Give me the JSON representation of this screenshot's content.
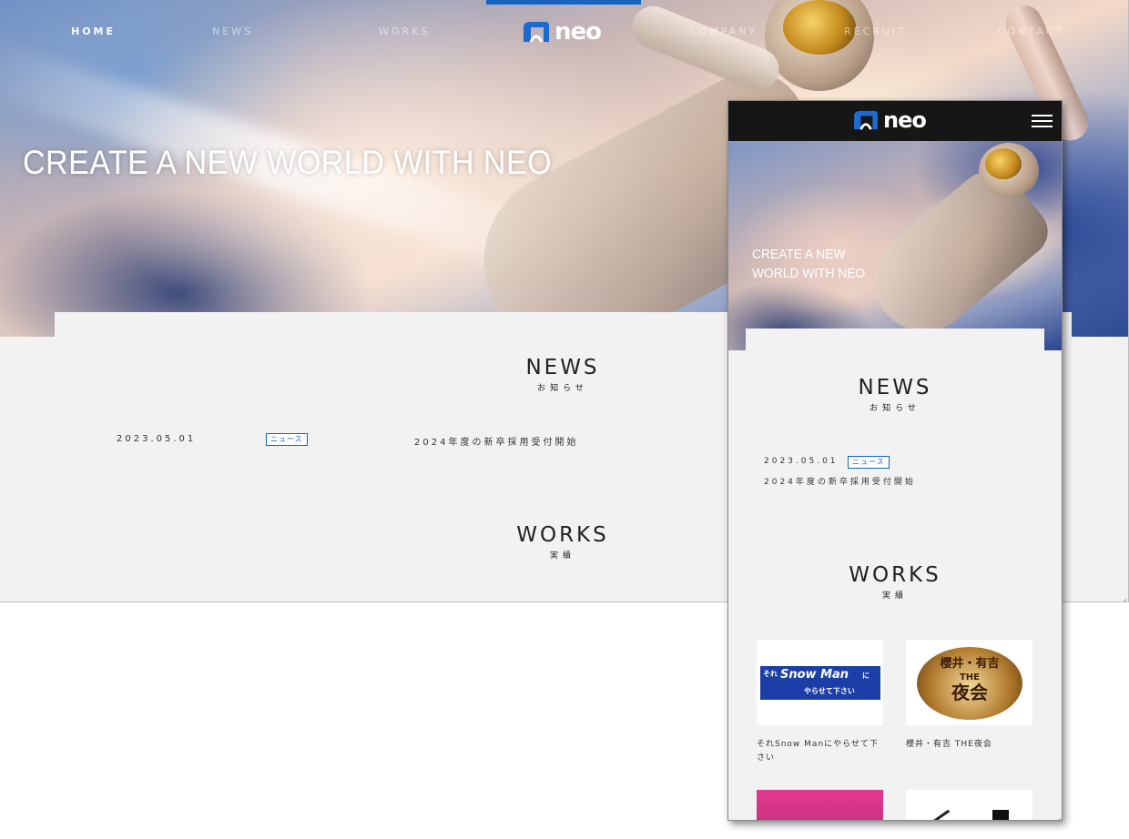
{
  "desktop": {
    "nav": [
      "HOME",
      "NEWS",
      "WORKS",
      "COMPANY",
      "RECRUIT",
      "CONTACT"
    ],
    "active_nav": "HOME",
    "logo_text": "neo",
    "hero_tagline": "CREATE A NEW WORLD WITH NEO",
    "news": {
      "title": "NEWS",
      "subtitle": "お知らせ",
      "items": [
        {
          "date": "2023.05.01",
          "category": "ニュース",
          "title": "2024年度の新卒採用受付開始"
        }
      ]
    },
    "works": {
      "title": "WORKS",
      "subtitle": "実績"
    }
  },
  "mobile": {
    "logo_text": "neo",
    "hero_tagline": "CREATE A NEW WORLD WITH NEO",
    "news": {
      "title": "NEWS",
      "subtitle": "お知らせ",
      "items": [
        {
          "date": "2023.05.01",
          "category": "ニュース",
          "title": "2024年度の新卒採用受付開始"
        }
      ]
    },
    "works": {
      "title": "WORKS",
      "subtitle": "実績",
      "items": [
        {
          "caption": "それSnow Manにやらせて下さい",
          "logo_text_1": "それ",
          "logo_text_2": "Snow Man",
          "logo_text_3": "に",
          "logo_text_4": "やらせて下さい"
        },
        {
          "caption": "櫻井・有吉 THE夜会",
          "logo_text_1": "櫻井・有吉",
          "logo_text_2": "THE",
          "logo_text_3": "夜会"
        }
      ]
    }
  },
  "colors": {
    "accent": "#1565c0",
    "header_dark": "#161616",
    "page_bg": "#f2f2f2"
  }
}
